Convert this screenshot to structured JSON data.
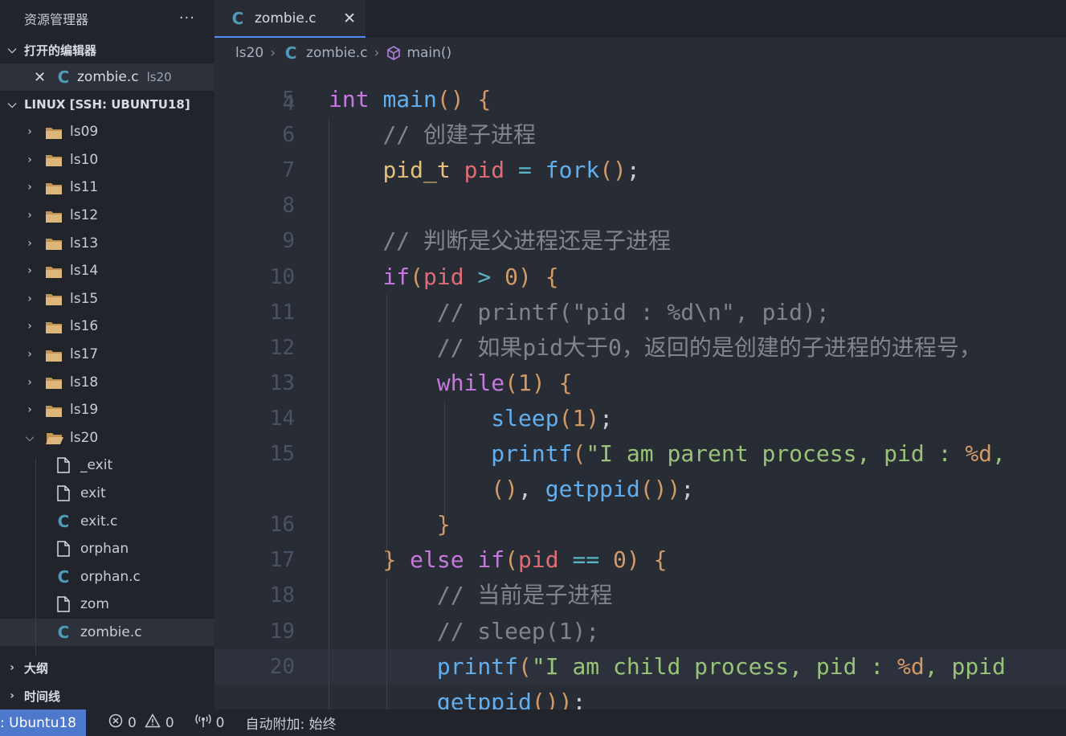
{
  "sidebar": {
    "title": "资源管理器",
    "more": "···",
    "open_editors": {
      "heading": "打开的编辑器",
      "items": [
        {
          "name": "zombie.c",
          "dir": "ls20"
        }
      ]
    },
    "workspace": {
      "heading": "LINUX [SSH: UBUNTU18]",
      "folders": [
        "ls09",
        "ls10",
        "ls11",
        "ls12",
        "ls13",
        "ls14",
        "ls15",
        "ls16",
        "ls17",
        "ls18",
        "ls19"
      ],
      "open_folder": "ls20",
      "files": [
        {
          "name": "_exit",
          "kind": "file"
        },
        {
          "name": "exit",
          "kind": "file"
        },
        {
          "name": "exit.c",
          "kind": "c"
        },
        {
          "name": "orphan",
          "kind": "file"
        },
        {
          "name": "orphan.c",
          "kind": "c"
        },
        {
          "name": "zom",
          "kind": "file"
        },
        {
          "name": "zombie.c",
          "kind": "c",
          "selected": true
        }
      ]
    },
    "outline": "大纲",
    "timeline": "时间线"
  },
  "tabs": [
    {
      "label": "zombie.c",
      "active": true
    }
  ],
  "breadcrumb": {
    "folder": "ls20",
    "file": "zombie.c",
    "symbol": "main()"
  },
  "editor": {
    "partial_line_number": "4",
    "lines": [
      {
        "num": "5",
        "text": "int main() {"
      },
      {
        "num": "6",
        "text": "    // 创建子进程"
      },
      {
        "num": "7",
        "text": "    pid_t pid = fork();"
      },
      {
        "num": "8",
        "text": ""
      },
      {
        "num": "9",
        "text": "    // 判断是父进程还是子进程"
      },
      {
        "num": "10",
        "text": "    if(pid > 0) {"
      },
      {
        "num": "11",
        "text": "        // printf(\"pid : %d\\n\", pid);"
      },
      {
        "num": "12",
        "text": "        // 如果pid大于0，返回的是创建的子进程的进程号，"
      },
      {
        "num": "13",
        "text": "        while(1) {"
      },
      {
        "num": "14",
        "text": "            sleep(1);"
      },
      {
        "num": "15",
        "text": "            printf(\"I am parent process, pid : %d,"
      },
      {
        "num": "",
        "text": "            (), getppid());"
      },
      {
        "num": "16",
        "text": "        }"
      },
      {
        "num": "17",
        "text": "    } else if(pid == 0) {"
      },
      {
        "num": "18",
        "text": "        // 当前是子进程"
      },
      {
        "num": "19",
        "text": "        // sleep(1);"
      },
      {
        "num": "20",
        "text": "        printf(\"I am child process, pid : %d, ppid"
      },
      {
        "num": "",
        "text": "        getppid());"
      }
    ]
  },
  "statusbar": {
    "remote": ": Ubuntu18",
    "errors": "0",
    "warnings": "0",
    "ports": "0",
    "auto_attach": "自动附加: 始终"
  },
  "colors": {
    "accent": "#4d78cc",
    "c_icon": "#519aba",
    "folder": "#c09553"
  }
}
